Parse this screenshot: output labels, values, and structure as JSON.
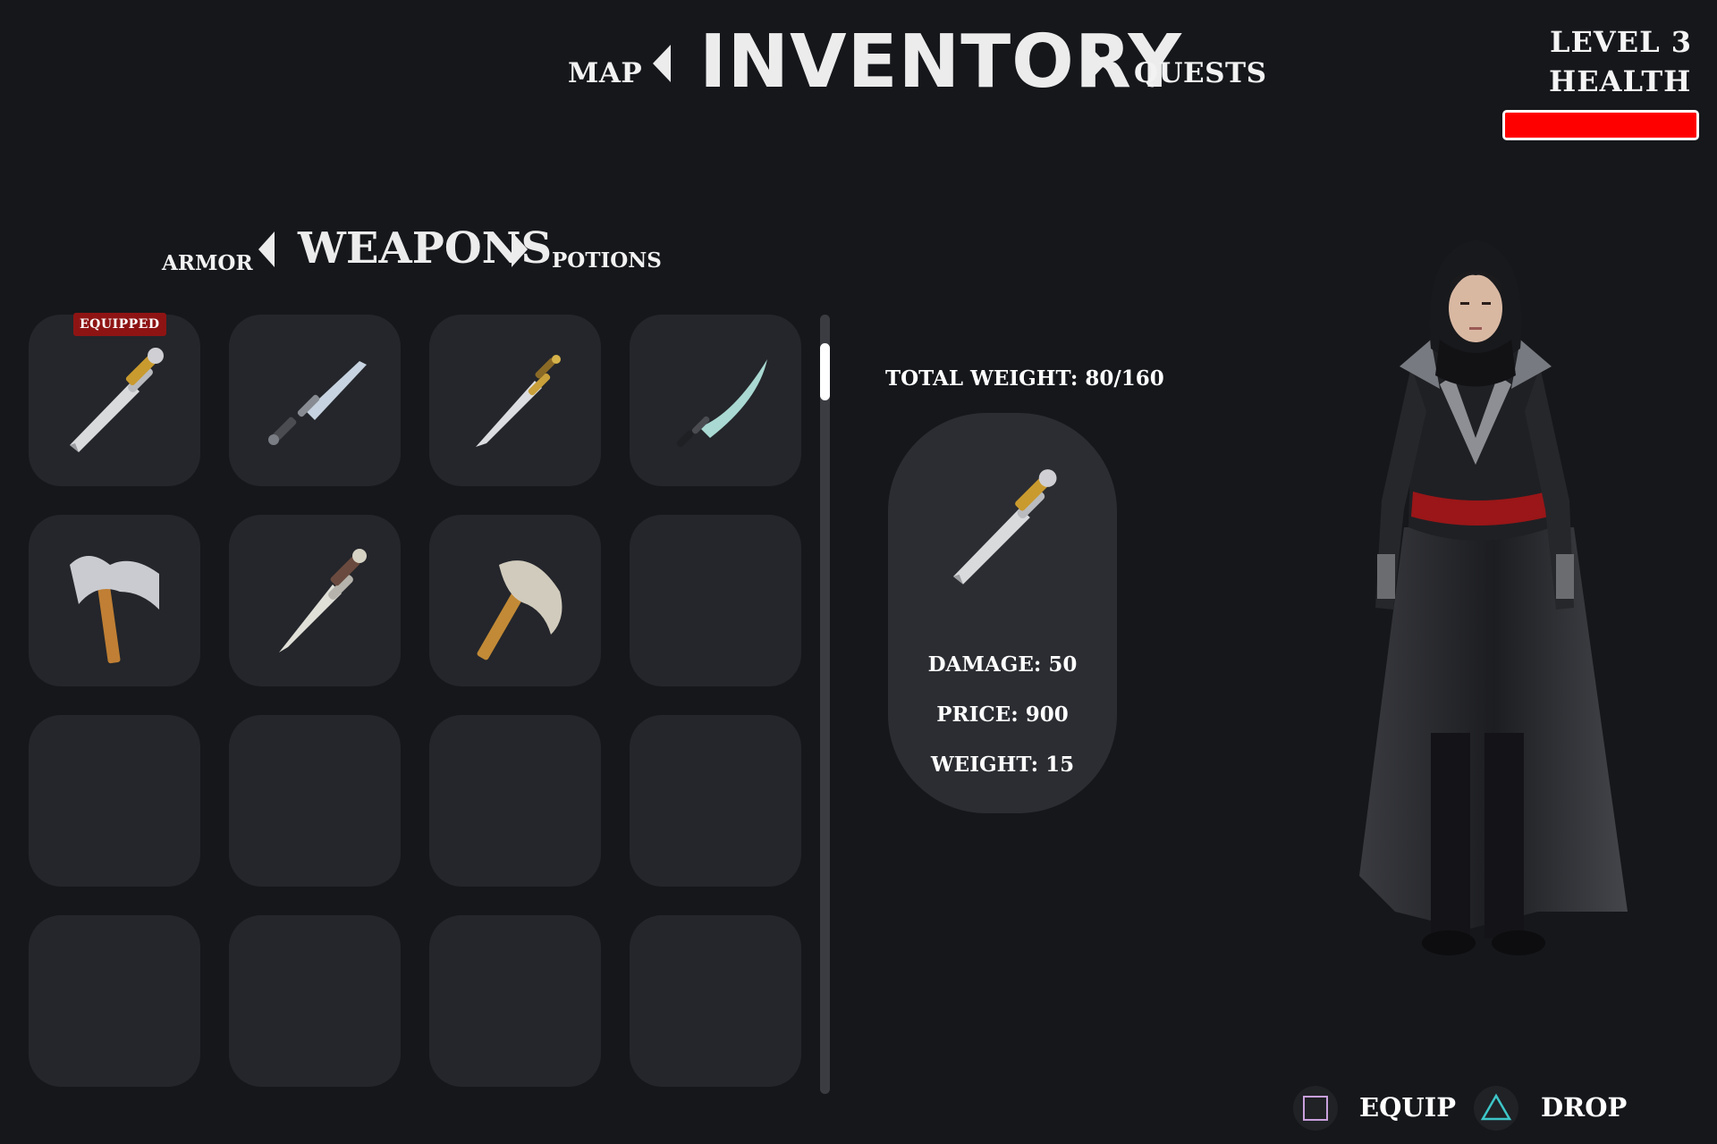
{
  "top_nav": {
    "left_label": "MAP",
    "title": "INVENTORY",
    "right_label": "QUESTS"
  },
  "hud": {
    "level_text": "LEVEL 3",
    "health_label": "HEALTH",
    "health_fraction": 1.0,
    "health_color": "#ff0000"
  },
  "categories": {
    "left_label": "ARMOR",
    "current": "WEAPONS",
    "right_label": "POTIONS"
  },
  "grid": {
    "badge_label": "EQUIPPED",
    "slots": [
      {
        "item": "sword-golden-hilt",
        "equipped": true
      },
      {
        "item": "steel-dagger",
        "equipped": false
      },
      {
        "item": "gilded-dagger",
        "equipped": false
      },
      {
        "item": "jade-scimitar",
        "equipped": false
      },
      {
        "item": "steel-axe",
        "equipped": false
      },
      {
        "item": "leather-hilt-sword",
        "equipped": false
      },
      {
        "item": "hand-axe",
        "equipped": false
      },
      {
        "item": null
      },
      {
        "item": null
      },
      {
        "item": null
      },
      {
        "item": null
      },
      {
        "item": null
      },
      {
        "item": null
      },
      {
        "item": null
      },
      {
        "item": null
      },
      {
        "item": null
      }
    ]
  },
  "details": {
    "total_weight": "TOTAL WEIGHT: 80/160",
    "damage": "DAMAGE: 50",
    "price": "PRICE: 900",
    "weight": "WEIGHT: 15",
    "item": "sword-golden-hilt"
  },
  "actions": {
    "equip_label": "EQUIP",
    "drop_label": "DROP",
    "equip_icon": "square-button-icon",
    "drop_icon": "triangle-button-icon",
    "square_color": "#c9a0dc",
    "triangle_color": "#3ec6c8"
  }
}
